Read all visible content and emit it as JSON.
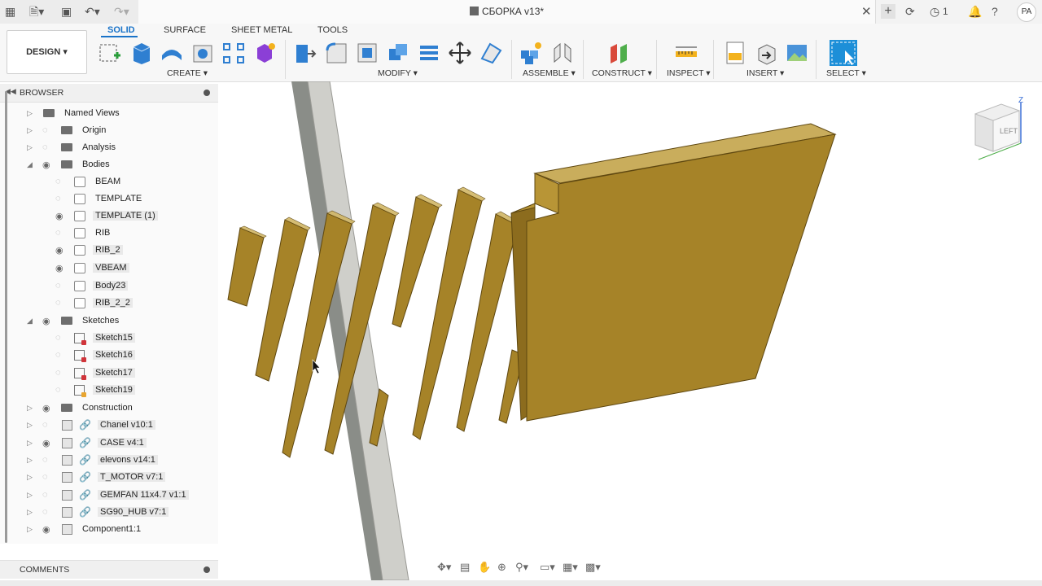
{
  "titlebar": {
    "document_title": "СБОРКА v13*",
    "job_count": "1",
    "avatar": "PA"
  },
  "toolbar": {
    "workspace": "DESIGN",
    "tabs": [
      "SOLID",
      "SURFACE",
      "SHEET METAL",
      "TOOLS"
    ],
    "active_tab": "SOLID",
    "groups": [
      "CREATE",
      "MODIFY",
      "ASSEMBLE",
      "CONSTRUCT",
      "INSPECT",
      "INSERT",
      "SELECT"
    ]
  },
  "browser": {
    "title": "BROWSER",
    "items": [
      {
        "label": "Named Views"
      },
      {
        "label": "Origin"
      },
      {
        "label": "Analysis"
      },
      {
        "label": "Bodies"
      },
      {
        "label": "BEAM"
      },
      {
        "label": "TEMPLATE"
      },
      {
        "label": "TEMPLATE (1)"
      },
      {
        "label": "RIB"
      },
      {
        "label": "RIB_2"
      },
      {
        "label": "VBEAM"
      },
      {
        "label": "Body23"
      },
      {
        "label": "RIB_2_2"
      },
      {
        "label": "Sketches"
      },
      {
        "label": "Sketch15"
      },
      {
        "label": "Sketch16"
      },
      {
        "label": "Sketch17"
      },
      {
        "label": "Sketch19"
      },
      {
        "label": "Construction"
      },
      {
        "label": "Chanel v10:1"
      },
      {
        "label": "CASE v4:1"
      },
      {
        "label": "elevons v14:1"
      },
      {
        "label": "T_MOTOR v7:1"
      },
      {
        "label": "GEMFAN 11x4.7 v1:1"
      },
      {
        "label": "SG90_HUB v7:1"
      },
      {
        "label": "Component1:1"
      }
    ]
  },
  "comments": {
    "title": "COMMENTS"
  },
  "viewcube": {
    "face": "LEFT",
    "axis": "Z"
  },
  "colors": {
    "accent": "#1a73c8",
    "body": "#a68328",
    "beam": "#c6c6c0"
  }
}
